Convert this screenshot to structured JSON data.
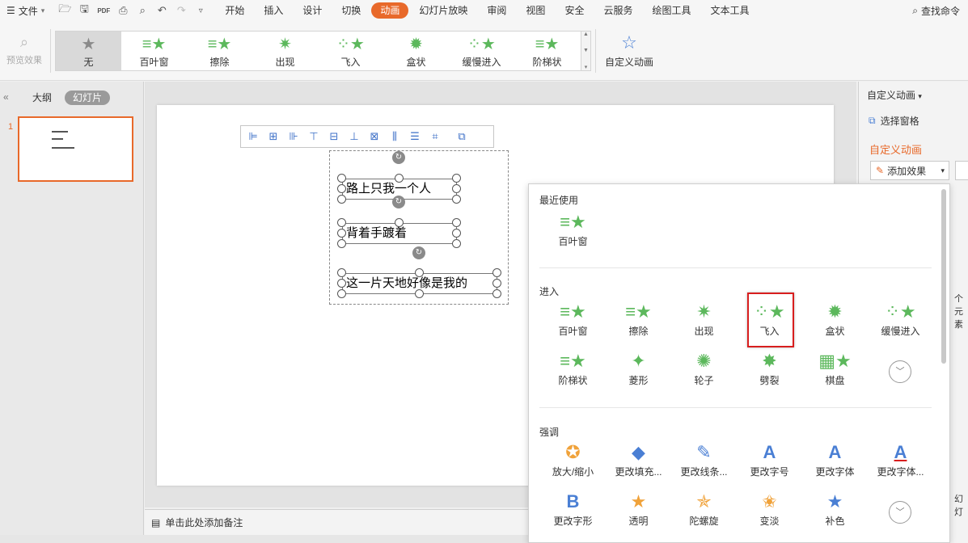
{
  "menubar": {
    "file_label": "文件",
    "tabs": [
      {
        "label": "开始"
      },
      {
        "label": "插入"
      },
      {
        "label": "设计"
      },
      {
        "label": "切换"
      },
      {
        "label": "动画"
      },
      {
        "label": "幻灯片放映"
      },
      {
        "label": "审阅"
      },
      {
        "label": "视图"
      },
      {
        "label": "安全"
      },
      {
        "label": "云服务"
      },
      {
        "label": "绘图工具"
      },
      {
        "label": "文本工具"
      }
    ],
    "active_tab": "动画",
    "search_label": "查找命令"
  },
  "ribbon": {
    "preview_label": "预览效果",
    "gallery": [
      "无",
      "百叶窗",
      "擦除",
      "出现",
      "飞入",
      "盒状",
      "缓慢进入",
      "阶梯状"
    ],
    "custom_animation_label": "自定义动画"
  },
  "left_panel": {
    "outline_tab": "大纲",
    "slides_tab": "幻灯片",
    "slide_number": "1"
  },
  "slide": {
    "text_boxes": [
      "路上只我一个人",
      "背着手踱着",
      "这一片天地好像是我的"
    ]
  },
  "notes": {
    "placeholder": "单击此处添加备注"
  },
  "right_panel": {
    "title": "自定义动画",
    "select_pane": "选择窗格",
    "section_title": "自定义动画",
    "add_effect": "添加效果",
    "fragment_1": "个元素",
    "fragment_2": "幻灯"
  },
  "effects_dropdown": {
    "recent_title": "最近使用",
    "recent": [
      "百叶窗"
    ],
    "enter_title": "进入",
    "enter": [
      "百叶窗",
      "擦除",
      "出现",
      "飞入",
      "盒状",
      "缓慢进入",
      "阶梯状",
      "菱形",
      "轮子",
      "劈裂",
      "棋盘"
    ],
    "emphasis_title": "强调",
    "emphasis": [
      "放大/缩小",
      "更改填充...",
      "更改线条...",
      "更改字号",
      "更改字体",
      "更改字体...",
      "更改字形",
      "透明",
      "陀螺旋",
      "变淡",
      "补色"
    ],
    "highlighted_effect": "飞入"
  },
  "colors": {
    "accent": "#e8692a",
    "star_green": "#5cb85c",
    "star_orange": "#f0a23a",
    "highlight_red": "#d81e1e"
  }
}
